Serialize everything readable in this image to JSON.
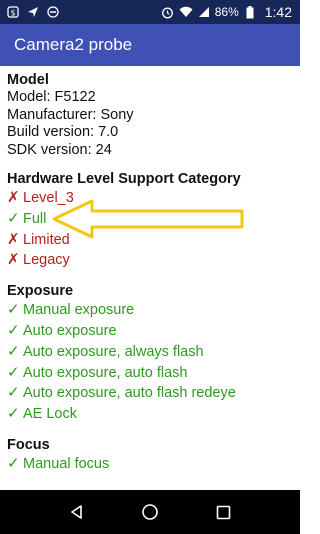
{
  "status_bar": {
    "battery_percent": "86%",
    "time": "1:42",
    "left_icons": [
      "dollar-icon",
      "send-icon",
      "no-sim-icon"
    ],
    "right_icons": [
      "alarm-icon",
      "wifi-icon",
      "signal-icon",
      "battery-icon"
    ]
  },
  "app_bar": {
    "title": "Camera2 probe"
  },
  "model_section": {
    "title": "Model",
    "lines": [
      "Model: F5122",
      "Manufacturer: Sony",
      "Build version: 7.0",
      "SDK version: 24"
    ]
  },
  "hardware_section": {
    "title": "Hardware Level Support Category",
    "items": [
      {
        "label": "Level_3",
        "supported": false,
        "mark": "✗"
      },
      {
        "label": "Full",
        "supported": true,
        "mark": "✓"
      },
      {
        "label": "Limited",
        "supported": false,
        "mark": "✗"
      },
      {
        "label": "Legacy",
        "supported": false,
        "mark": "✗"
      }
    ]
  },
  "exposure_section": {
    "title": "Exposure",
    "items": [
      {
        "label": "Manual exposure",
        "supported": true,
        "mark": "✓"
      },
      {
        "label": "Auto exposure",
        "supported": true,
        "mark": "✓"
      },
      {
        "label": "Auto exposure, always flash",
        "supported": true,
        "mark": "✓"
      },
      {
        "label": "Auto exposure, auto flash",
        "supported": true,
        "mark": "✓"
      },
      {
        "label": "Auto exposure, auto flash redeye",
        "supported": true,
        "mark": "✓"
      },
      {
        "label": "AE Lock",
        "supported": true,
        "mark": "✓"
      }
    ]
  },
  "focus_section": {
    "title": "Focus",
    "items": [
      {
        "label": "Manual focus",
        "supported": true,
        "mark": "✓"
      }
    ]
  },
  "colors": {
    "status_bar": "#172858",
    "app_bar": "#3f51b5",
    "supported": "#2e9b1e",
    "unsupported": "#b3201f",
    "annotation_arrow": "#f5c518"
  },
  "nav_bar": {
    "icons": [
      "back-icon",
      "home-icon",
      "recents-icon"
    ]
  }
}
